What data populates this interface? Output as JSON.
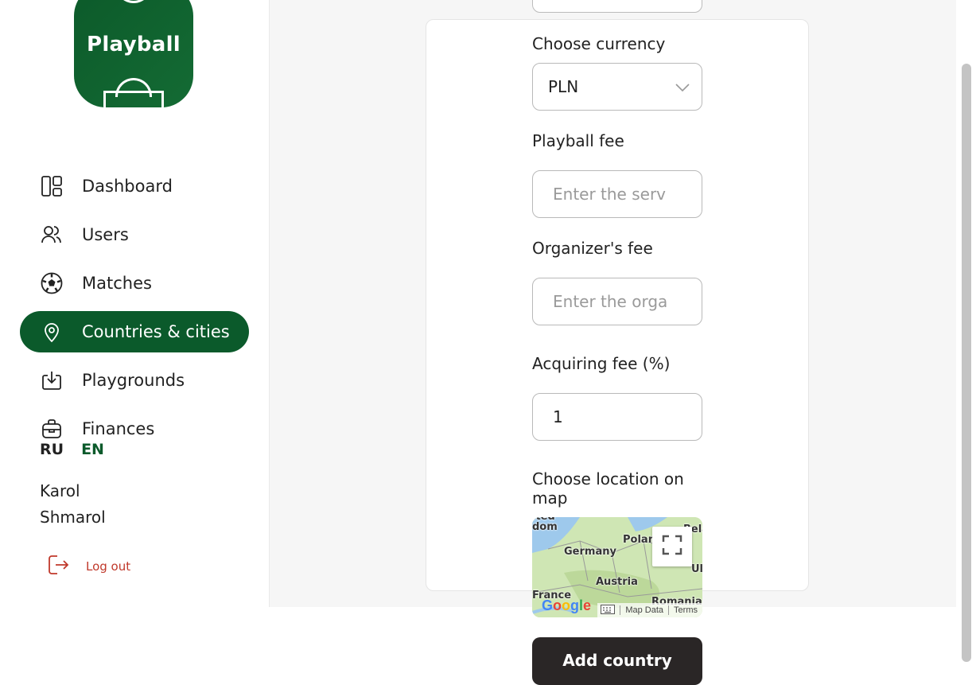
{
  "brand": {
    "logo_text": "Playball",
    "accent": "#0b5a2b"
  },
  "sidebar": {
    "items": [
      {
        "label": "Dashboard",
        "icon": "dashboard-icon",
        "active": false
      },
      {
        "label": "Users",
        "icon": "users-icon",
        "active": false
      },
      {
        "label": "Matches",
        "icon": "soccer-ball-icon",
        "active": false
      },
      {
        "label": "Countries & cities",
        "icon": "map-pin-icon",
        "active": true
      },
      {
        "label": "Playgrounds",
        "icon": "download-tray-icon",
        "active": false
      },
      {
        "label": "Finances",
        "icon": "briefcase-icon",
        "active": false
      }
    ],
    "lang": {
      "ru": "RU",
      "en": "EN",
      "selected": "EN"
    },
    "user": {
      "first": "Karol",
      "last": "Shmarol"
    },
    "logout_label": "Log out"
  },
  "form": {
    "currency_label": "Choose currency",
    "currency_value": "PLN",
    "playball_fee_label": "Playball fee",
    "playball_fee_placeholder": "Enter the serv",
    "organizer_fee_label": "Organizer's fee",
    "organizer_fee_placeholder": "Enter the orga",
    "acquiring_fee_label": "Acquiring fee (%)",
    "acquiring_fee_value": "1",
    "map_label": "Choose location on map",
    "submit_label": "Add country"
  },
  "map": {
    "labels": [
      "ited",
      "dom",
      "Germany",
      "Polan",
      "Belar",
      "Austria",
      "Ul",
      "France",
      "Romania"
    ],
    "attribution": {
      "data": "Map Data",
      "terms": "Terms"
    },
    "google": "Google"
  }
}
